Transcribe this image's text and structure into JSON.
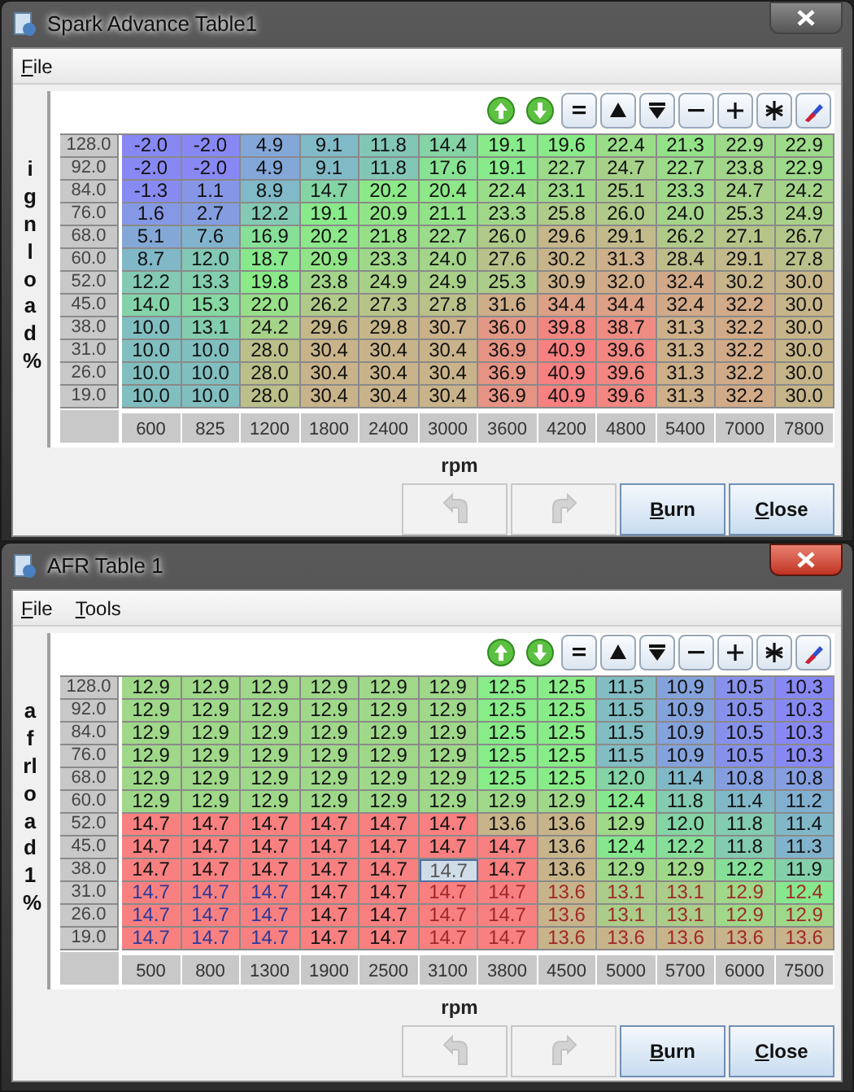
{
  "windows": [
    {
      "title": "Spark Advance Table1",
      "active": false,
      "menu": [
        {
          "label": "File"
        }
      ],
      "y_axis_label": "ignload %",
      "x_axis_label": "rpm",
      "rows": [
        {
          "load": "128.0",
          "cells": [
            "-2.0",
            "-2.0",
            "4.9",
            "9.1",
            "11.8",
            "14.4",
            "19.1",
            "19.6",
            "22.4",
            "21.3",
            "22.9",
            "22.9"
          ]
        },
        {
          "load": "92.0",
          "cells": [
            "-2.0",
            "-2.0",
            "4.9",
            "9.1",
            "11.8",
            "17.6",
            "19.1",
            "22.7",
            "24.7",
            "22.7",
            "23.8",
            "22.9"
          ]
        },
        {
          "load": "84.0",
          "cells": [
            "-1.3",
            "1.1",
            "8.9",
            "14.7",
            "20.2",
            "20.4",
            "22.4",
            "23.1",
            "25.1",
            "23.3",
            "24.7",
            "24.2"
          ]
        },
        {
          "load": "76.0",
          "cells": [
            "1.6",
            "2.7",
            "12.2",
            "19.1",
            "20.9",
            "21.1",
            "23.3",
            "25.8",
            "26.0",
            "24.0",
            "25.3",
            "24.9"
          ]
        },
        {
          "load": "68.0",
          "cells": [
            "5.1",
            "7.6",
            "16.9",
            "20.2",
            "21.8",
            "22.7",
            "26.0",
            "29.6",
            "29.1",
            "26.2",
            "27.1",
            "26.7"
          ]
        },
        {
          "load": "60.0",
          "cells": [
            "8.7",
            "12.0",
            "18.7",
            "20.9",
            "23.3",
            "24.0",
            "27.6",
            "30.2",
            "31.3",
            "28.4",
            "29.1",
            "27.8"
          ]
        },
        {
          "load": "52.0",
          "cells": [
            "12.2",
            "13.3",
            "19.8",
            "23.8",
            "24.9",
            "24.9",
            "25.3",
            "30.9",
            "32.0",
            "32.4",
            "30.2",
            "30.0"
          ]
        },
        {
          "load": "45.0",
          "cells": [
            "14.0",
            "15.3",
            "22.0",
            "26.2",
            "27.3",
            "27.8",
            "31.6",
            "34.4",
            "34.4",
            "32.4",
            "32.2",
            "30.0"
          ]
        },
        {
          "load": "38.0",
          "cells": [
            "10.0",
            "13.1",
            "24.2",
            "29.6",
            "29.8",
            "30.7",
            "36.0",
            "39.8",
            "38.7",
            "31.3",
            "32.2",
            "30.0"
          ]
        },
        {
          "load": "31.0",
          "cells": [
            "10.0",
            "10.0",
            "28.0",
            "30.4",
            "30.4",
            "30.4",
            "36.9",
            "40.9",
            "39.6",
            "31.3",
            "32.2",
            "30.0"
          ]
        },
        {
          "load": "26.0",
          "cells": [
            "10.0",
            "10.0",
            "28.0",
            "30.4",
            "30.4",
            "30.4",
            "36.9",
            "40.9",
            "39.6",
            "31.3",
            "32.2",
            "30.0"
          ]
        },
        {
          "load": "19.0",
          "cells": [
            "10.0",
            "10.0",
            "28.0",
            "30.4",
            "30.4",
            "30.4",
            "36.9",
            "40.9",
            "39.6",
            "31.3",
            "32.2",
            "30.0"
          ]
        }
      ],
      "rpm": [
        "600",
        "825",
        "1200",
        "1800",
        "2400",
        "3000",
        "3600",
        "4200",
        "4800",
        "5400",
        "7000",
        "7800"
      ],
      "buttons": [
        {
          "kind": "undo",
          "disabled": true
        },
        {
          "kind": "redo",
          "disabled": true
        },
        {
          "kind": "text",
          "label": "Burn"
        },
        {
          "kind": "text",
          "label": "Close"
        }
      ]
    },
    {
      "title": "AFR Table 1",
      "active": true,
      "menu": [
        {
          "label": "File"
        },
        {
          "label": "Tools"
        }
      ],
      "y_axis_label": "afrload1 %",
      "x_axis_label": "rpm",
      "rows": [
        {
          "load": "128.0",
          "cells": [
            "12.9",
            "12.9",
            "12.9",
            "12.9",
            "12.9",
            "12.9",
            "12.5",
            "12.5",
            "11.5",
            "10.9",
            "10.5",
            "10.3"
          ]
        },
        {
          "load": "92.0",
          "cells": [
            "12.9",
            "12.9",
            "12.9",
            "12.9",
            "12.9",
            "12.9",
            "12.5",
            "12.5",
            "11.5",
            "10.9",
            "10.5",
            "10.3"
          ]
        },
        {
          "load": "84.0",
          "cells": [
            "12.9",
            "12.9",
            "12.9",
            "12.9",
            "12.9",
            "12.9",
            "12.5",
            "12.5",
            "11.5",
            "10.9",
            "10.5",
            "10.3"
          ]
        },
        {
          "load": "76.0",
          "cells": [
            "12.9",
            "12.9",
            "12.9",
            "12.9",
            "12.9",
            "12.9",
            "12.5",
            "12.5",
            "11.5",
            "10.9",
            "10.5",
            "10.3"
          ]
        },
        {
          "load": "68.0",
          "cells": [
            "12.9",
            "12.9",
            "12.9",
            "12.9",
            "12.9",
            "12.9",
            "12.5",
            "12.5",
            "12.0",
            "11.4",
            "10.8",
            "10.8"
          ]
        },
        {
          "load": "60.0",
          "cells": [
            "12.9",
            "12.9",
            "12.9",
            "12.9",
            "12.9",
            "12.9",
            "12.9",
            "12.9",
            "12.4",
            "11.8",
            "11.4",
            "11.2"
          ]
        },
        {
          "load": "52.0",
          "cells": [
            "14.7",
            "14.7",
            "14.7",
            "14.7",
            "14.7",
            "14.7",
            "13.6",
            "13.6",
            "12.9",
            "12.0",
            "11.8",
            "11.4"
          ]
        },
        {
          "load": "45.0",
          "cells": [
            "14.7",
            "14.7",
            "14.7",
            "14.7",
            "14.7",
            "14.7",
            "14.7",
            "13.6",
            "12.4",
            "12.2",
            "11.8",
            "11.3"
          ]
        },
        {
          "load": "38.0",
          "cells": [
            "14.7",
            "14.7",
            "14.7",
            "14.7",
            "14.7",
            {
              "value": "14.7",
              "selected": true
            },
            "14.7",
            "13.6",
            "12.9",
            "12.9",
            "12.2",
            "11.9"
          ]
        },
        {
          "load": "31.0",
          "cells": [
            {
              "value": "14.7",
              "kind": "blue"
            },
            {
              "value": "14.7",
              "kind": "blue"
            },
            {
              "value": "14.7",
              "kind": "blue"
            },
            "14.7",
            "14.7",
            {
              "value": "14.7",
              "kind": "red"
            },
            {
              "value": "14.7",
              "kind": "red"
            },
            {
              "value": "13.6",
              "kind": "red"
            },
            {
              "value": "13.1",
              "kind": "red"
            },
            {
              "value": "13.1",
              "kind": "red"
            },
            {
              "value": "12.9",
              "kind": "red"
            },
            {
              "value": "12.4",
              "kind": "red"
            }
          ]
        },
        {
          "load": "26.0",
          "cells": [
            {
              "value": "14.7",
              "kind": "blue"
            },
            {
              "value": "14.7",
              "kind": "blue"
            },
            {
              "value": "14.7",
              "kind": "blue"
            },
            "14.7",
            "14.7",
            {
              "value": "14.7",
              "kind": "red"
            },
            {
              "value": "14.7",
              "kind": "red"
            },
            {
              "value": "13.6",
              "kind": "red"
            },
            {
              "value": "13.1",
              "kind": "red"
            },
            {
              "value": "13.1",
              "kind": "red"
            },
            {
              "value": "12.9",
              "kind": "red"
            },
            {
              "value": "12.9",
              "kind": "red"
            }
          ]
        },
        {
          "load": "19.0",
          "cells": [
            {
              "value": "14.7",
              "kind": "blue"
            },
            {
              "value": "14.7",
              "kind": "blue"
            },
            {
              "value": "14.7",
              "kind": "blue"
            },
            "14.7",
            "14.7",
            {
              "value": "14.7",
              "kind": "red"
            },
            {
              "value": "14.7",
              "kind": "red"
            },
            {
              "value": "13.6",
              "kind": "red"
            },
            {
              "value": "13.6",
              "kind": "red"
            },
            {
              "value": "13.6",
              "kind": "red"
            },
            {
              "value": "13.6",
              "kind": "red"
            },
            {
              "value": "13.6",
              "kind": "red"
            }
          ]
        }
      ],
      "rpm": [
        "500",
        "800",
        "1300",
        "1900",
        "2500",
        "3100",
        "3800",
        "4500",
        "5000",
        "5700",
        "6000",
        "7500"
      ],
      "buttons": [
        {
          "kind": "undo",
          "disabled": true
        },
        {
          "kind": "redo",
          "disabled": true
        },
        {
          "kind": "text",
          "label": "Burn"
        },
        {
          "kind": "text",
          "label": "Close"
        }
      ]
    }
  ]
}
